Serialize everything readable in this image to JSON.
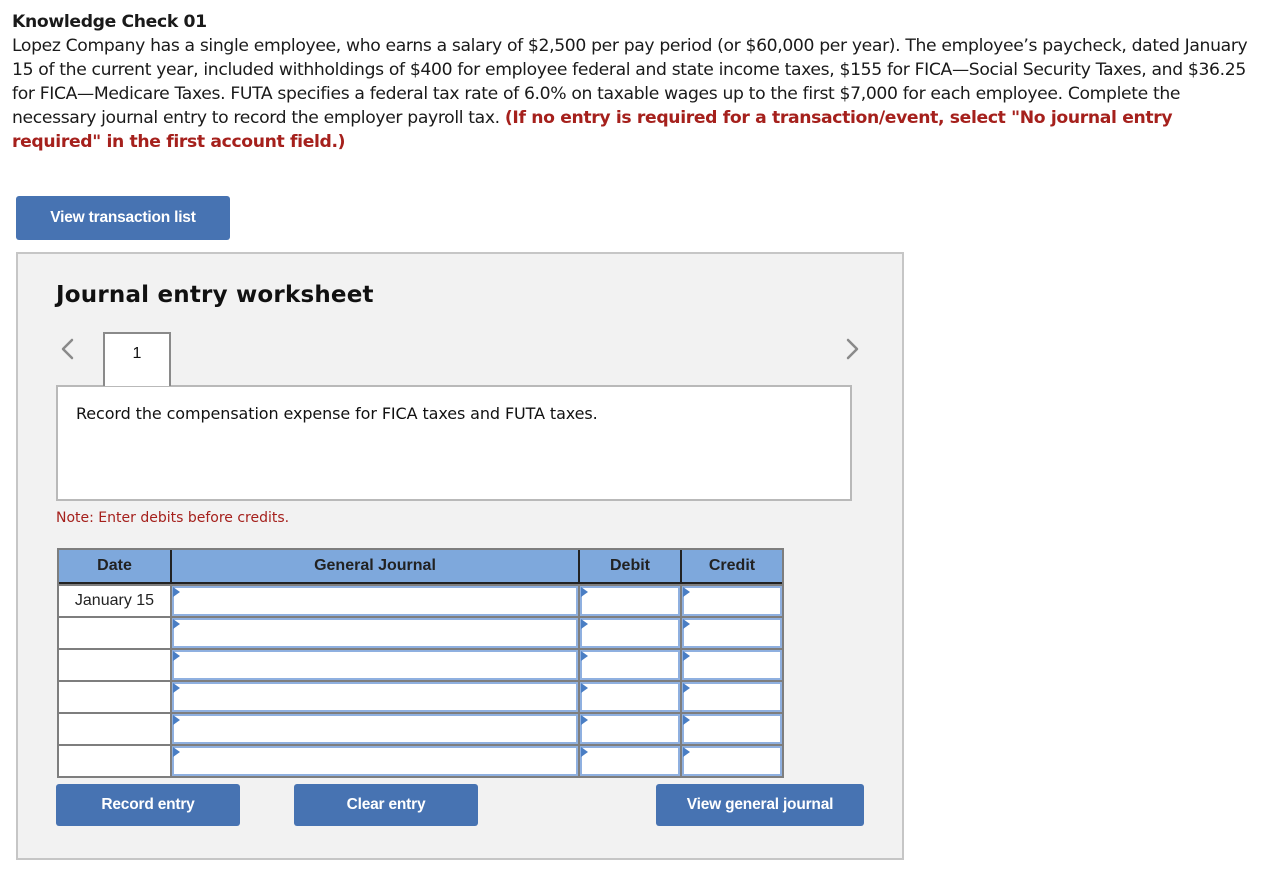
{
  "question": {
    "title": "Knowledge Check 01",
    "body": "Lopez Company has a single employee, who earns a salary of $2,500 per pay period (or $60,000 per year). The employee’s paycheck, dated January 15 of the current year, included withholdings of $400 for employee federal and state income taxes, $155 for FICA—Social Security Taxes, and $36.25 for FICA—Medicare Taxes. FUTA specifies a federal tax rate of 6.0% on taxable wages up to the first $7,000 for each employee. Complete the necessary journal entry to record the employer payroll tax. ",
    "hint": "(If no entry is required for a transaction/event, select \"No journal entry required\" in the first account field.)"
  },
  "buttons": {
    "view_transaction_list": "View transaction list",
    "record_entry": "Record entry",
    "clear_entry": "Clear entry",
    "view_general_journal": "View general journal"
  },
  "worksheet": {
    "title": "Journal entry worksheet",
    "current_tab": "1",
    "instructions": "Record the compensation expense for FICA taxes and FUTA taxes.",
    "note": "Note: Enter debits before credits."
  },
  "journal": {
    "headers": [
      "Date",
      "General Journal",
      "Debit",
      "Credit"
    ],
    "rows": [
      {
        "date": "January 15",
        "account": "",
        "debit": "",
        "credit": ""
      },
      {
        "date": "",
        "account": "",
        "debit": "",
        "credit": ""
      },
      {
        "date": "",
        "account": "",
        "debit": "",
        "credit": ""
      },
      {
        "date": "",
        "account": "",
        "debit": "",
        "credit": ""
      },
      {
        "date": "",
        "account": "",
        "debit": "",
        "credit": ""
      },
      {
        "date": "",
        "account": "",
        "debit": "",
        "credit": ""
      }
    ]
  },
  "colors": {
    "button_blue": "#4773b2",
    "header_blue": "#7ea8dc",
    "hint_red": "#a5201c"
  }
}
